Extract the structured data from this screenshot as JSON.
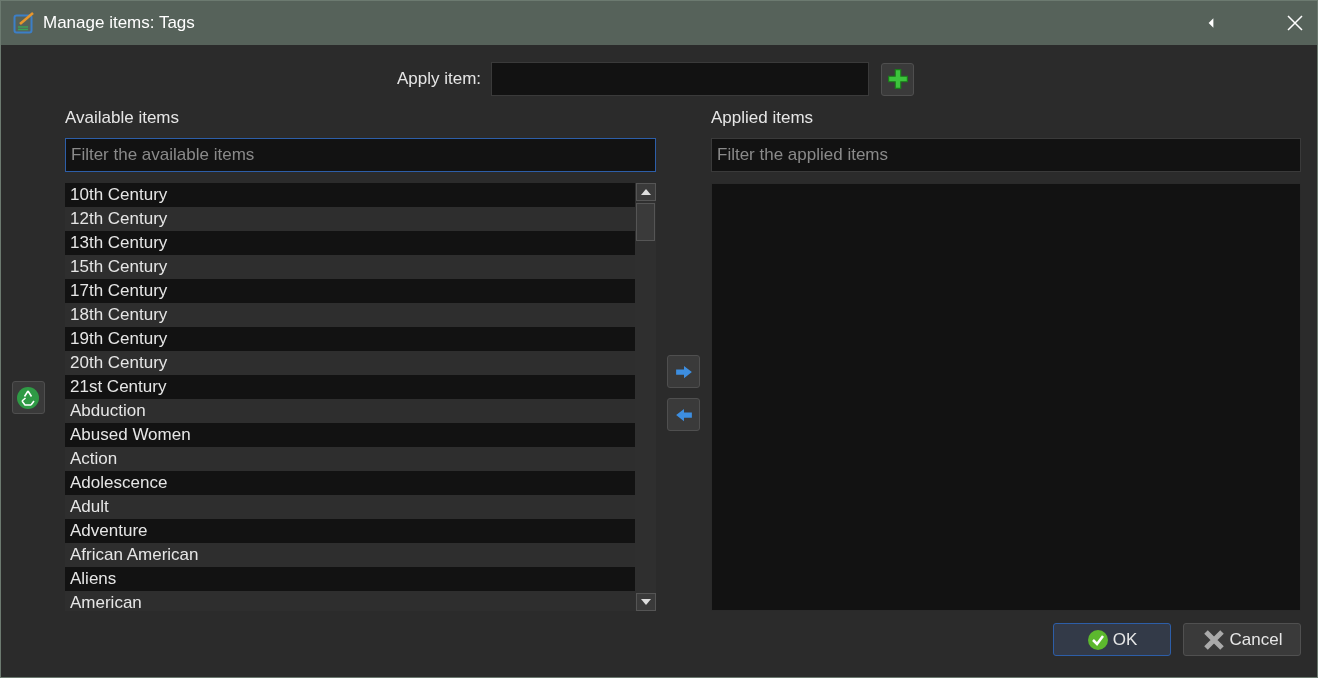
{
  "window": {
    "title": "Manage items: Tags"
  },
  "apply_item": {
    "label": "Apply item:"
  },
  "available": {
    "label": "Available items",
    "filter": {
      "placeholder": "Filter the available items",
      "focused": true
    },
    "items": [
      "10th Century",
      "12th Century",
      "13th Century",
      "15th Century",
      "17th Century",
      "18th Century",
      "19th Century",
      "20th Century",
      "21st Century",
      "Abduction",
      "Abused Women",
      "Action",
      "Adolescence",
      "Adult",
      "Adventure",
      "African American",
      "Aliens",
      "American"
    ]
  },
  "applied": {
    "label": "Applied items",
    "filter": {
      "placeholder": "Filter the applied items",
      "focused": false
    }
  },
  "buttons": [
    {
      "kind": "ok",
      "label": "OK",
      "default": true
    },
    {
      "kind": "cancel",
      "label": "Cancel",
      "default": false
    }
  ]
}
